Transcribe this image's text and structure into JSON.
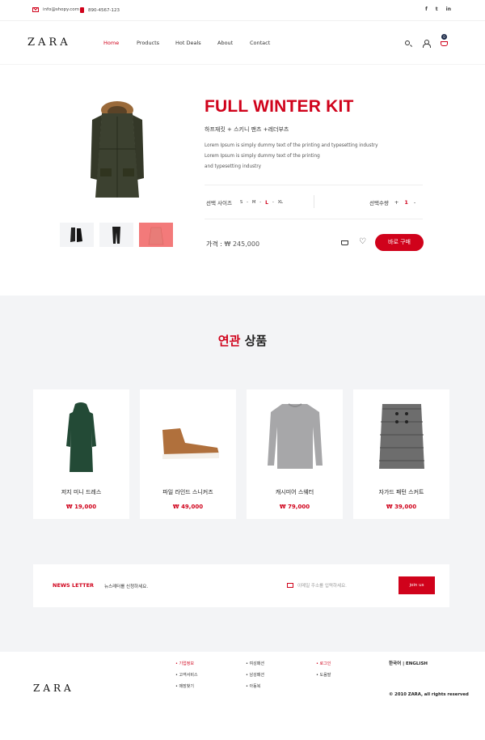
{
  "topbar": {
    "email": "info@shopy.com",
    "phone": "890-4567-123",
    "social": [
      "f",
      "t",
      "in"
    ]
  },
  "header": {
    "logo": "ZARA",
    "nav": [
      "Home",
      "Products",
      "Hot Deals",
      "About",
      "Contact"
    ],
    "active_nav": "Home",
    "cart_count": "0"
  },
  "product": {
    "title": "FULL WINTER KIT",
    "subtitle": "하프재킷 + 스키니 팬츠 +레더부츠",
    "description": [
      "Lorem Ipsum is simply dummy text of the printing and typesetting industry",
      "Lorem Ipsum is simply dummy text of the printing",
      "and typesetting industry"
    ],
    "size_label": "선택 사이즈",
    "sizes": [
      "S",
      "-",
      "M",
      "-",
      "L",
      "-",
      "XL"
    ],
    "selected_size": "L",
    "qty_label": "선택수량",
    "qty_minus": "+",
    "qty_value": "1",
    "qty_plus": "-",
    "price_label": "가격 :",
    "price_value": "₩ 245,000",
    "buy_label": "바로 구매"
  },
  "related": {
    "title_highlight": "연관",
    "title_rest": "상품",
    "items": [
      {
        "name": "저지 미니 드레스",
        "price": "₩ 19,000"
      },
      {
        "name": "파일 라인드 스니커즈",
        "price": "₩ 49,000"
      },
      {
        "name": "캐시미어 스웨터",
        "price": "₩ 79,000"
      },
      {
        "name": "자가드 패턴 스커트",
        "price": "₩ 39,000"
      }
    ]
  },
  "newsletter": {
    "title": "NEWS LETTER",
    "desc": "뉴스레터를 신청하세요.",
    "placeholder": "이메일 주소를 입력하세요.",
    "button": "join us"
  },
  "footer": {
    "logo": "ZARA",
    "col1": [
      "기업정보",
      "고객서비스",
      "매장찾기"
    ],
    "col2": [
      "여성패션",
      "남성패션",
      "아동복"
    ],
    "col3": [
      "로그인",
      "도움말"
    ],
    "lang": "한국어 | ENGLISH",
    "copyright": "© 2010 ZARA, all rights reserved"
  },
  "colors": {
    "accent": "#d0021b",
    "section_bg": "#f3f4f6"
  }
}
